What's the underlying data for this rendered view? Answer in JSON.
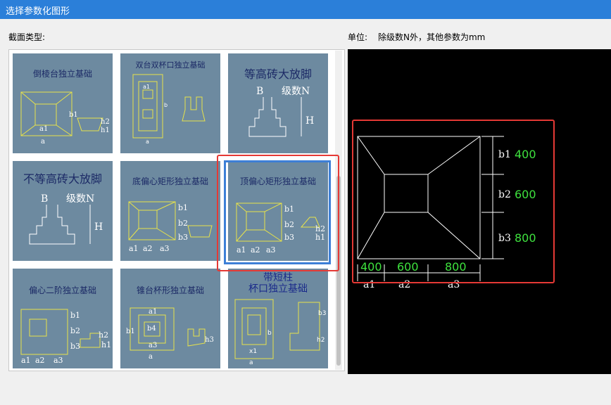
{
  "window": {
    "title": "选择参数化图形"
  },
  "labels": {
    "section_type": "截面类型:",
    "units": "单位:",
    "units_note": "除级数N外，其他参数为mm"
  },
  "cells": [
    {
      "title": "倒棱台独立基础"
    },
    {
      "title": "双台双杯口独立基础"
    },
    {
      "title": "等高砖大放脚"
    },
    {
      "title": "不等高砖大放脚"
    },
    {
      "title": "底偏心矩形独立基础"
    },
    {
      "title": "顶偏心矩形独立基础"
    },
    {
      "title": "偏心二阶独立基础"
    },
    {
      "title": "锥台杯形独立基础"
    },
    {
      "title_line1": "带短柱",
      "title_line2": "杯口独立基础"
    }
  ],
  "preview": {
    "b1": "b1",
    "b2": "b2",
    "b3": "b3",
    "b1_val": "400",
    "b2_val": "600",
    "b3_val": "800",
    "a1": "a1",
    "a2": "a2",
    "a3": "a3",
    "a1_val": "400",
    "a2_val": "600",
    "a3_val": "800"
  },
  "colors": {
    "titlebar": "#2b7fd9",
    "highlight": "#e53935",
    "selection": "#3d7fd6",
    "value": "#3ee23e"
  }
}
